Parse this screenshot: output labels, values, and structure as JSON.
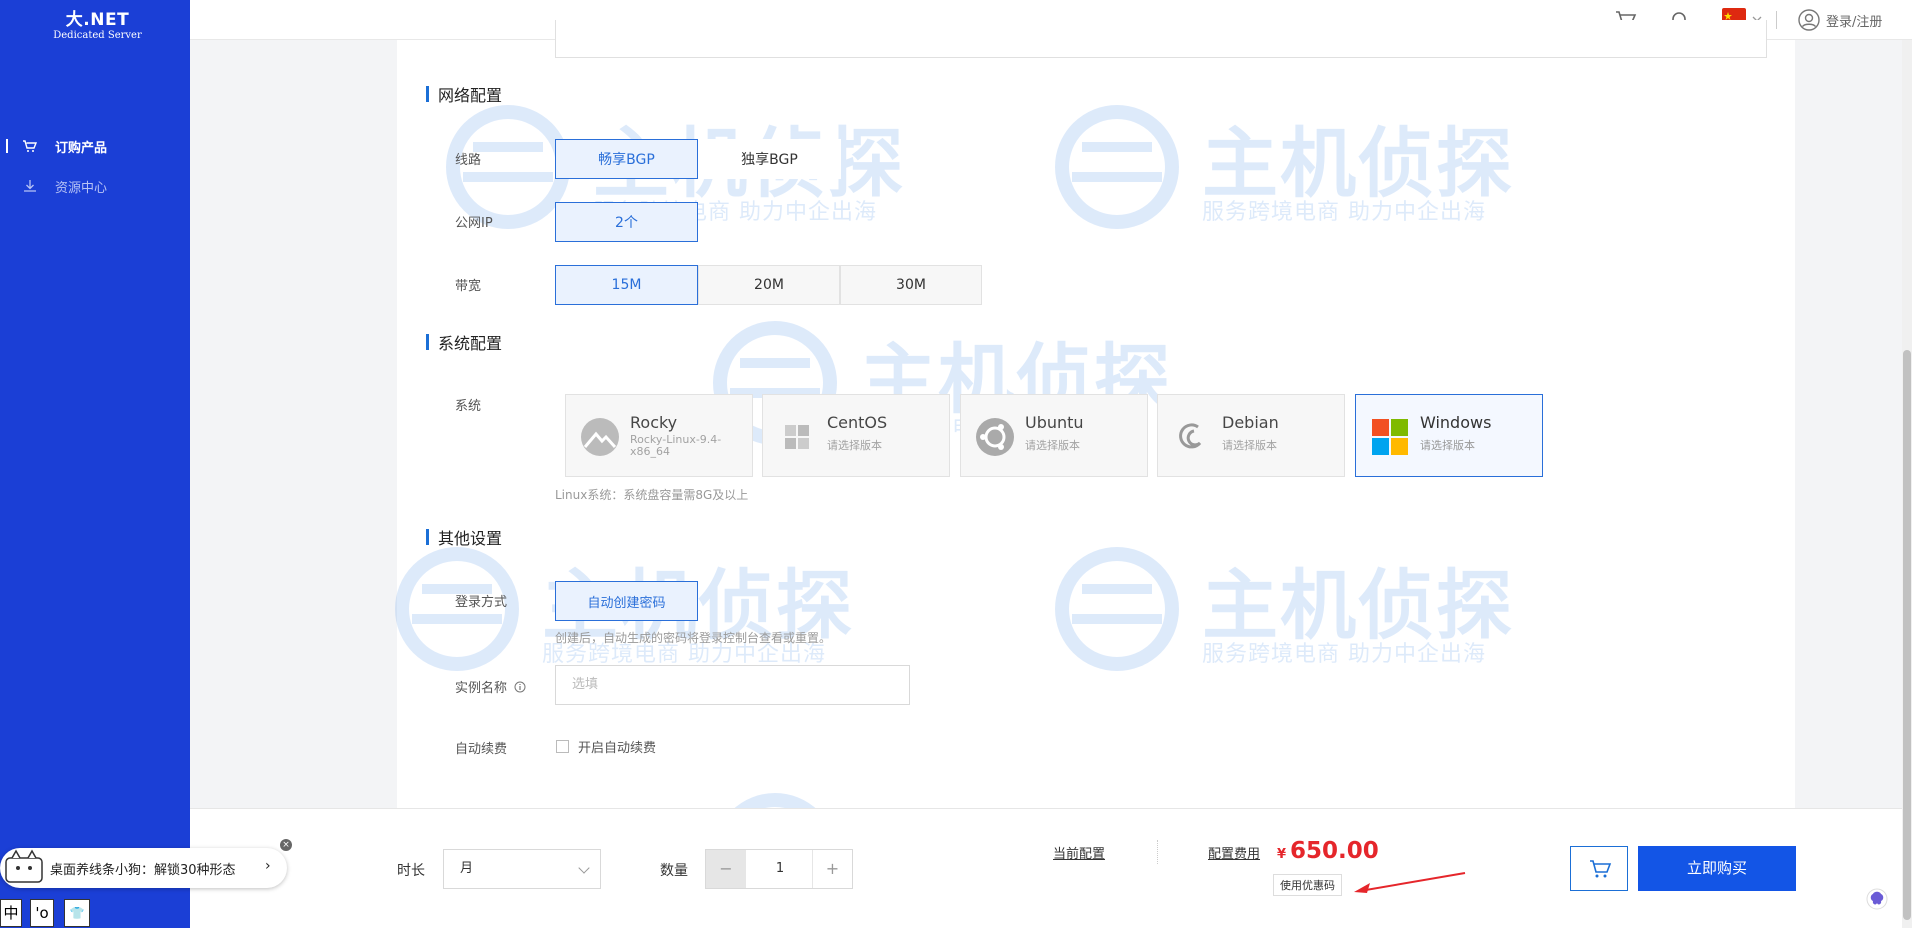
{
  "logo": {
    "main": "大.NET",
    "sub": "Dedicated Server"
  },
  "sidebar": {
    "items": [
      {
        "label": "订购产品",
        "icon": "cart-icon"
      },
      {
        "label": "资源中心",
        "icon": "download-icon"
      }
    ]
  },
  "topbar": {
    "icons": [
      "cart-icon",
      "bell-icon",
      "china-flag-icon",
      "user-icon"
    ],
    "login": "登录/注册"
  },
  "network": {
    "title": "网络配置",
    "line_label": "线路",
    "lines": [
      "畅享BGP",
      "独享BGP"
    ],
    "selected_line": "畅享BGP",
    "ip_label": "公网IP",
    "ip_value": "2个",
    "bandwidth_label": "带宽",
    "bandwidths": [
      "15M",
      "20M",
      "30M"
    ],
    "selected_bandwidth": "15M"
  },
  "system": {
    "title": "系统配置",
    "os_label": "系统",
    "options": [
      {
        "name": "Rocky",
        "sub": "Rocky-Linux-9.4-x86_64",
        "icon": "rocky-logo-icon"
      },
      {
        "name": "CentOS",
        "sub": "请选择版本",
        "icon": "centos-logo-icon"
      },
      {
        "name": "Ubuntu",
        "sub": "请选择版本",
        "icon": "ubuntu-logo-icon"
      },
      {
        "name": "Debian",
        "sub": "请选择版本",
        "icon": "debian-logo-icon"
      },
      {
        "name": "Windows",
        "sub": "请选择版本",
        "icon": "windows-logo-icon"
      }
    ],
    "selected": "Windows",
    "hint": "Linux系统：系统盘容量需8G及以上"
  },
  "other": {
    "title": "其他设置",
    "login_label": "登录方式",
    "login_option": "自动创建密码",
    "login_hint": "创建后，自动生成的密码将登录控制台查看或重置。",
    "instance_label": "实例名称",
    "instance_placeholder": "选填",
    "renew_label": "自动续费",
    "renew_checkbox": "开启自动续费",
    "renew_checked": false
  },
  "watermark": {
    "main": "主机侦探",
    "sub": "服务跨境电商 助力中企出海"
  },
  "bottom": {
    "duration_label": "时长",
    "duration_value": "月",
    "quantity_label": "数量",
    "quantity_value": "1",
    "minus": "−",
    "plus": "+",
    "current_config": "当前配置",
    "fee_label": "配置费用",
    "currency": "¥",
    "price": "650.00",
    "coupon": "使用优惠码",
    "buy": "立即购买"
  },
  "widget": {
    "text": "桌面养线条小狗：解锁30种形态",
    "arrow": "›",
    "close": "×",
    "ime": [
      "中",
      "'o",
      "👕"
    ]
  },
  "colors": {
    "sidebar": "#1b3fd6",
    "accent": "#2a6fd9",
    "buy": "#1355e6",
    "price": "#e5262b"
  }
}
